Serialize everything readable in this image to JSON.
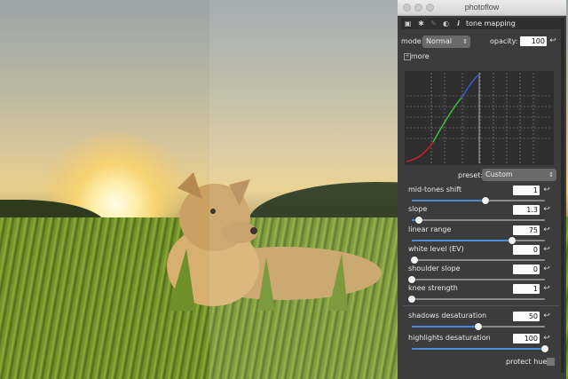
{
  "window": {
    "title": "photoflow"
  },
  "toolbar": {
    "module_name": "tone mapping",
    "info_icon": "i"
  },
  "mode": {
    "label": "mode:",
    "value": "Normal",
    "opacity_label": "opacity:",
    "opacity_value": "100"
  },
  "more_label": "more",
  "preset": {
    "label": "preset:",
    "value": "Custom"
  },
  "sliders": [
    {
      "label": "mid-tones shift",
      "value": "1",
      "fraction": 0.55
    },
    {
      "label": "slope",
      "value": "1.3",
      "fraction": 0.05
    },
    {
      "label": "linear range",
      "value": "75",
      "fraction": 0.75
    },
    {
      "label": "white level (EV)",
      "value": "0",
      "fraction": 0.02
    },
    {
      "label": "shoulder slope",
      "value": "0",
      "fraction": 0.0
    },
    {
      "label": "knee strength",
      "value": "1",
      "fraction": 0.0
    },
    {
      "label": "shadows desaturation",
      "value": "50",
      "fraction": 0.5
    },
    {
      "label": "highlights desaturation",
      "value": "100",
      "fraction": 1.0
    }
  ],
  "protect_hues": {
    "label": "protect hues",
    "checked": false
  },
  "colors": {
    "accent": "#4e8ad8",
    "curve_red": "#d4202a",
    "curve_green": "#3ec43e",
    "curve_blue": "#3d5bd8"
  }
}
